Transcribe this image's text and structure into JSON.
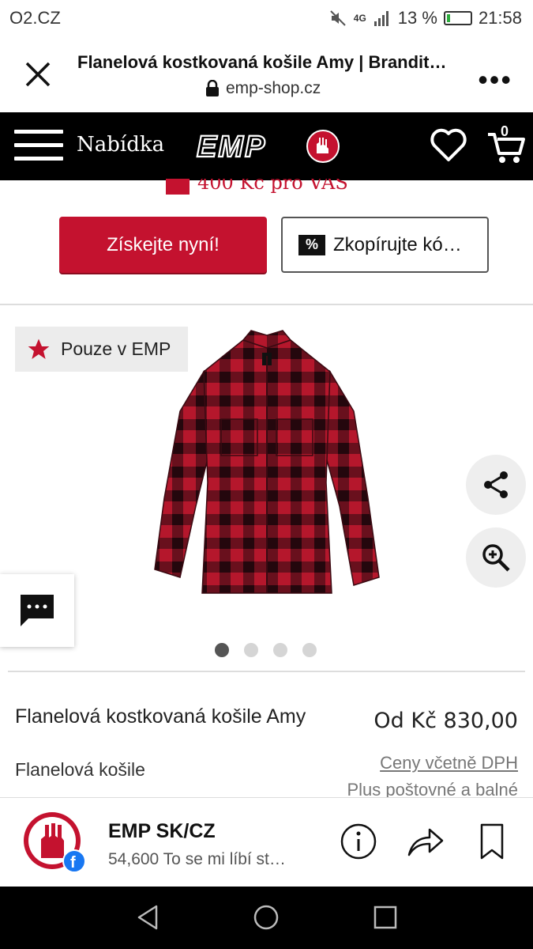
{
  "status": {
    "carrier": "O2.CZ",
    "battery": "13 %",
    "time": "21:58",
    "network": "4G"
  },
  "browser": {
    "title": "Flanelová kostkovaná košile Amy | Brandit…",
    "url": "emp-shop.cz"
  },
  "site": {
    "menu_label": "Nabídka",
    "logo_text": "EMP",
    "cart_count": "0"
  },
  "promo": {
    "text": "400 Kč pro VÁS",
    "get_now": "Získejte nyní!",
    "copy_code": "Zkopírujte kó…"
  },
  "gallery": {
    "badge": "Pouze v EMP",
    "slides": 4,
    "active_slide": 1
  },
  "product": {
    "name": "Flanelová kostkovaná košile Amy",
    "subtitle": "Flanelová košile",
    "price": "Od Kč 830,00",
    "vat": "Ceny včetně DPH",
    "shipping": "Plus poštovné a balné"
  },
  "facebook": {
    "name": "EMP SK/CZ",
    "likes": "54,600 To se mi líbí st…"
  },
  "colors": {
    "brand_red": "#c4122f",
    "header_bg": "#000000"
  }
}
